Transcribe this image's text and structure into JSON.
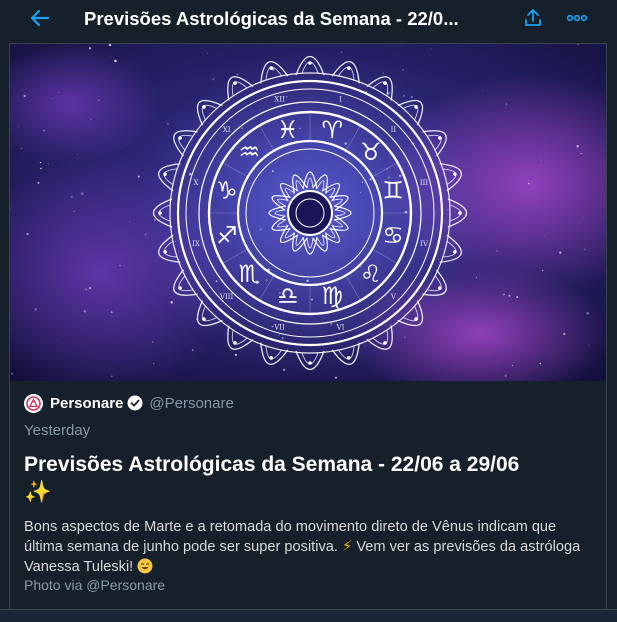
{
  "header": {
    "title": "Previsões Astrológicas da Semana - 22/0..."
  },
  "card": {
    "author": {
      "name": "Personare",
      "handle": "@Personare",
      "verified": true
    },
    "timestamp": "Yesterday",
    "headline": "Previsões Astrológicas da Semana - 22/06 a 29/06",
    "headline_emoji": "✨",
    "description_part1": "Bons aspectos de Marte e a retomada do movimento direto de Vênus indicam que última semana de junho pode ser super positiva. ",
    "description_bolt": "⚡",
    "description_part2": " Vem ver as previsões da astróloga Vanessa Tuleski! ",
    "photo_credit": "Photo via @Personare",
    "image": {
      "zodiac_signs": [
        "♈",
        "♉",
        "♊",
        "♋",
        "♌",
        "♍",
        "♎",
        "♏",
        "♐",
        "♑",
        "♒",
        "♓"
      ],
      "roman_numerals": [
        "I",
        "II",
        "III",
        "IV",
        "V",
        "VI",
        "VII",
        "VIII",
        "IX",
        "X",
        "XI",
        "XII"
      ]
    }
  },
  "colors": {
    "background": "#15202b",
    "accent": "#1da1f2",
    "secondary_text": "#8899a6",
    "border": "#38444d"
  },
  "icons": {
    "back": "arrow-left-icon",
    "share": "share-icon",
    "more": "more-icon",
    "verified": "verified-badge-icon"
  }
}
